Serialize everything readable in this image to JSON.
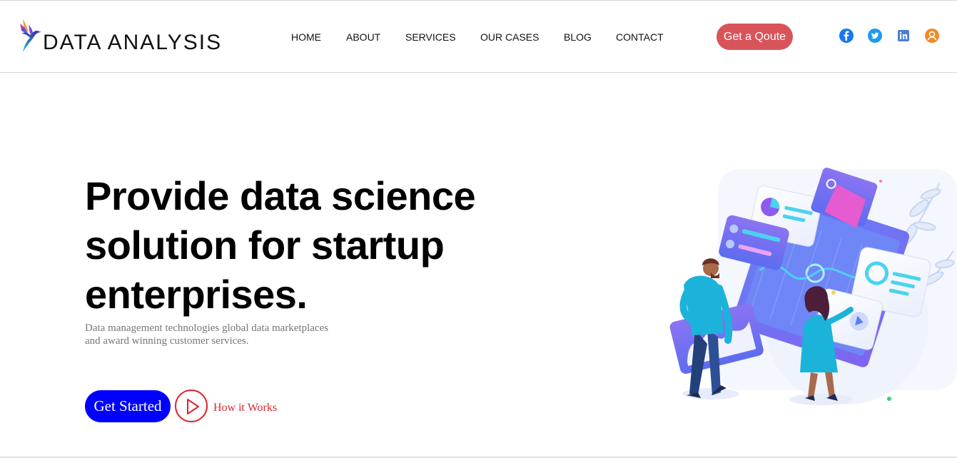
{
  "brand": {
    "name": "DATA ANALYSIS",
    "accent": "#0000ff"
  },
  "nav": {
    "items": [
      {
        "label": "HOME"
      },
      {
        "label": "ABOUT"
      },
      {
        "label": "SERVICES"
      },
      {
        "label": "OUR CASES"
      },
      {
        "label": "BLOG"
      },
      {
        "label": "CONTACT"
      }
    ]
  },
  "header": {
    "quote_button": "Get a Qoute",
    "quote_color": "#d9545a",
    "social_icons": [
      "facebook-icon",
      "twitter-icon",
      "linkedin-icon",
      "user-icon"
    ]
  },
  "hero": {
    "title_line1": "Provide data science",
    "title_line2": "solution for startup",
    "title_line3": "enterprises.",
    "subtitle_line1": "Data management technologies global data marketplaces",
    "subtitle_line2": "and award winning customer services.",
    "cta_label": "Get Started",
    "how_label": "How it Works",
    "link_color": "#e0232f"
  }
}
